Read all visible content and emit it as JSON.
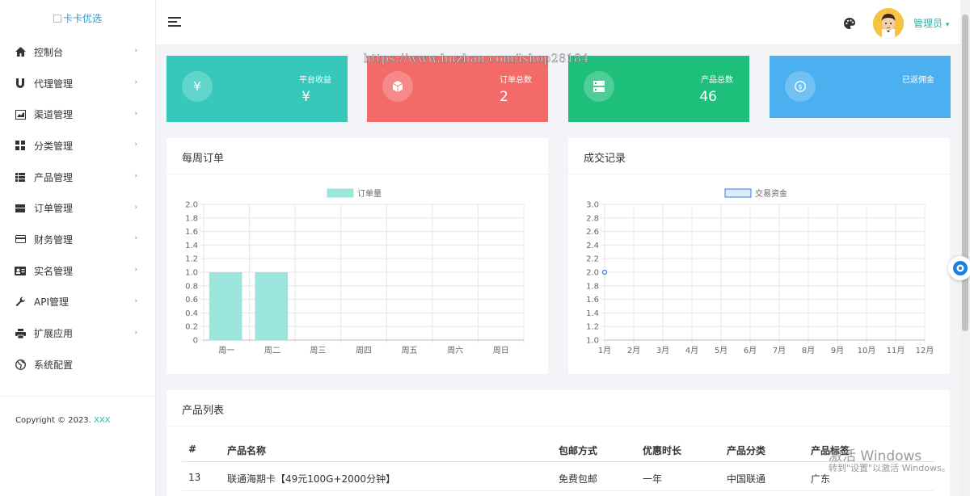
{
  "logo": {
    "alt_text": "卡卡优选"
  },
  "sidebar": {
    "items": [
      {
        "label": "控制台",
        "icon": "home-icon"
      },
      {
        "label": "代理管理",
        "icon": "magnet-icon"
      },
      {
        "label": "渠道管理",
        "icon": "chart-image-icon"
      },
      {
        "label": "分类管理",
        "icon": "grid-icon"
      },
      {
        "label": "产品管理",
        "icon": "list-icon"
      },
      {
        "label": "订单管理",
        "icon": "box-icon"
      },
      {
        "label": "财务管理",
        "icon": "credit-card-icon"
      },
      {
        "label": "实名管理",
        "icon": "id-card-icon"
      },
      {
        "label": "API管理",
        "icon": "wrench-icon"
      },
      {
        "label": "扩展应用",
        "icon": "printer-icon"
      },
      {
        "label": "系统配置",
        "icon": "globe-icon"
      }
    ],
    "chevron": "›",
    "copyright_prefix": "Copyright © 2023.",
    "copyright_link": "XXX"
  },
  "header": {
    "user_label": "管理员",
    "user_caret": "▾"
  },
  "watermark": "https://www.huzhan.com/ishop28184",
  "stats": [
    {
      "label": "平台收益",
      "value": "¥",
      "icon": "yen-icon",
      "color": "#36c9bb"
    },
    {
      "label": "订单总数",
      "value": "2",
      "icon": "cube-icon",
      "color": "#f46a69"
    },
    {
      "label": "产品总数",
      "value": "46",
      "icon": "server-icon",
      "color": "#1ebf7a"
    },
    {
      "label": "已返佣金",
      "value": "",
      "icon": "coin-icon",
      "color": "#4ab0ef"
    }
  ],
  "weekly": {
    "title": "每周订单",
    "chart_data": {
      "type": "bar",
      "categories": [
        "周一",
        "周二",
        "周三",
        "周四",
        "周五",
        "周六",
        "周日"
      ],
      "series": [
        {
          "name": "订单量",
          "values": [
            1,
            1,
            0,
            0,
            0,
            0,
            0
          ]
        }
      ],
      "ylim": [
        0,
        2.0
      ],
      "yticks": [
        "2.0",
        "1.8",
        "1.6",
        "1.4",
        "1.2",
        "1.0",
        "0.8",
        "0.6",
        "0.4",
        "0.2",
        "0"
      ],
      "legend": "top-center",
      "grid": true,
      "color": "#9be5dc"
    }
  },
  "deals": {
    "title": "成交记录",
    "chart_data": {
      "type": "line",
      "categories": [
        "1月",
        "2月",
        "3月",
        "4月",
        "5月",
        "6月",
        "7月",
        "8月",
        "9月",
        "10月",
        "11月",
        "12月"
      ],
      "series": [
        {
          "name": "交易资金",
          "values": [
            2.0
          ]
        }
      ],
      "ylim": [
        1.0,
        3.0
      ],
      "yticks": [
        "3.0",
        "2.8",
        "2.6",
        "2.4",
        "2.2",
        "2.0",
        "1.8",
        "1.6",
        "1.4",
        "1.2",
        "1.0"
      ],
      "legend": "top-center",
      "grid": true,
      "color": "#3a7bd5"
    }
  },
  "products": {
    "title": "产品列表",
    "headers": [
      "#",
      "产品名称",
      "包邮方式",
      "优惠时长",
      "产品分类",
      "产品标签"
    ],
    "rows": [
      [
        "13",
        "联通海期卡【49元100G+2000分钟】",
        "免费包邮",
        "一年",
        "中国联通",
        "广东"
      ]
    ]
  },
  "activation": {
    "line1": "激活 Windows",
    "line2": "转到\"设置\"以激活 Windows。"
  }
}
